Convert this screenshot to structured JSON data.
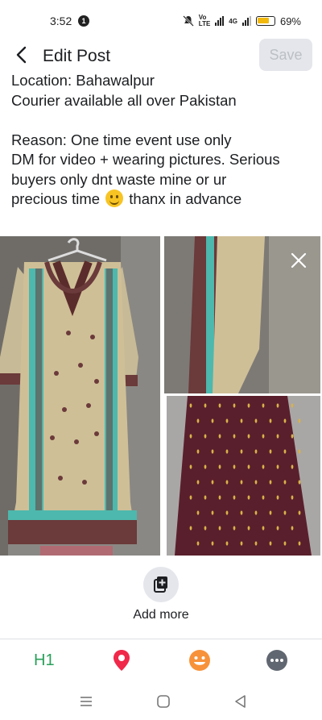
{
  "status_bar": {
    "time": "3:52",
    "notification_count": "1",
    "network": "4G",
    "battery_percent": "69%"
  },
  "header": {
    "title": "Edit Post",
    "save_label": "Save"
  },
  "post": {
    "lines": [
      "Location: Bahawalpur",
      "Courier available all over Pakistan",
      "",
      "Reason: One time event use only",
      "DM for video + wearing pictures. Serious",
      "buyers only dnt waste mine or ur"
    ],
    "last_line_before_emoji": "precious time",
    "last_line_after_emoji": "thanx in advance"
  },
  "photos": [
    "dress-front-photo",
    "dress-sleeve-photo",
    "dress-fabric-photo"
  ],
  "add_more": {
    "label": "Add more"
  },
  "toolbar": {
    "h1_label": "H1",
    "items": [
      "heading-tool",
      "location-icon",
      "emoji-icon",
      "more-icon"
    ],
    "colors": {
      "heading": "#2aa05a",
      "location": "#f0284a",
      "emoji": "#f7923a",
      "more": "#606770"
    }
  },
  "colors": {
    "save_disabled_bg": "#e4e6eb",
    "save_disabled_text": "#bcc0c4"
  }
}
